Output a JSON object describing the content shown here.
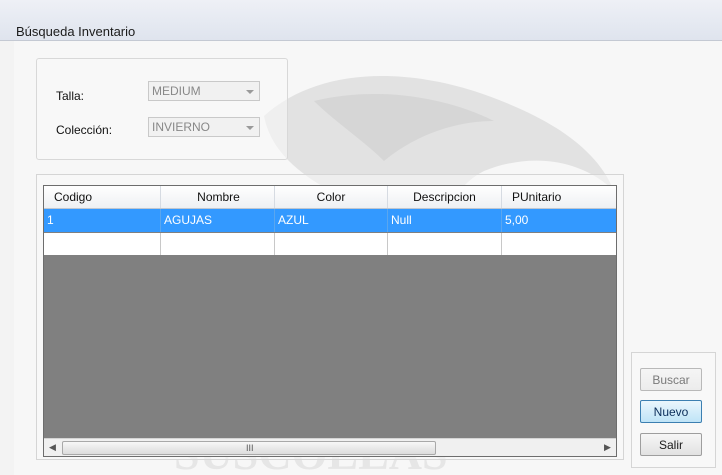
{
  "window": {
    "title": "Búsqueda Inventario"
  },
  "filters": {
    "talla_label": "Talla:",
    "talla_value": "MEDIUM",
    "coleccion_label": "Colección:",
    "coleccion_value": "INVIERNO"
  },
  "grid": {
    "columns": [
      "Codigo",
      "Nombre",
      "Color",
      "Descripcion",
      "PUnitario"
    ],
    "rows": [
      [
        "1",
        "AGUJAS",
        "AZUL",
        "Null",
        "5,00"
      ],
      [
        "",
        "",
        "",
        "",
        ""
      ]
    ],
    "selected_row": 0,
    "scroll_grip": "III"
  },
  "buttons": {
    "buscar": "Buscar",
    "nuevo": "Nuevo",
    "salir": "Salir"
  },
  "colors": {
    "selection": "#3399ff",
    "grid_background": "#808080"
  }
}
